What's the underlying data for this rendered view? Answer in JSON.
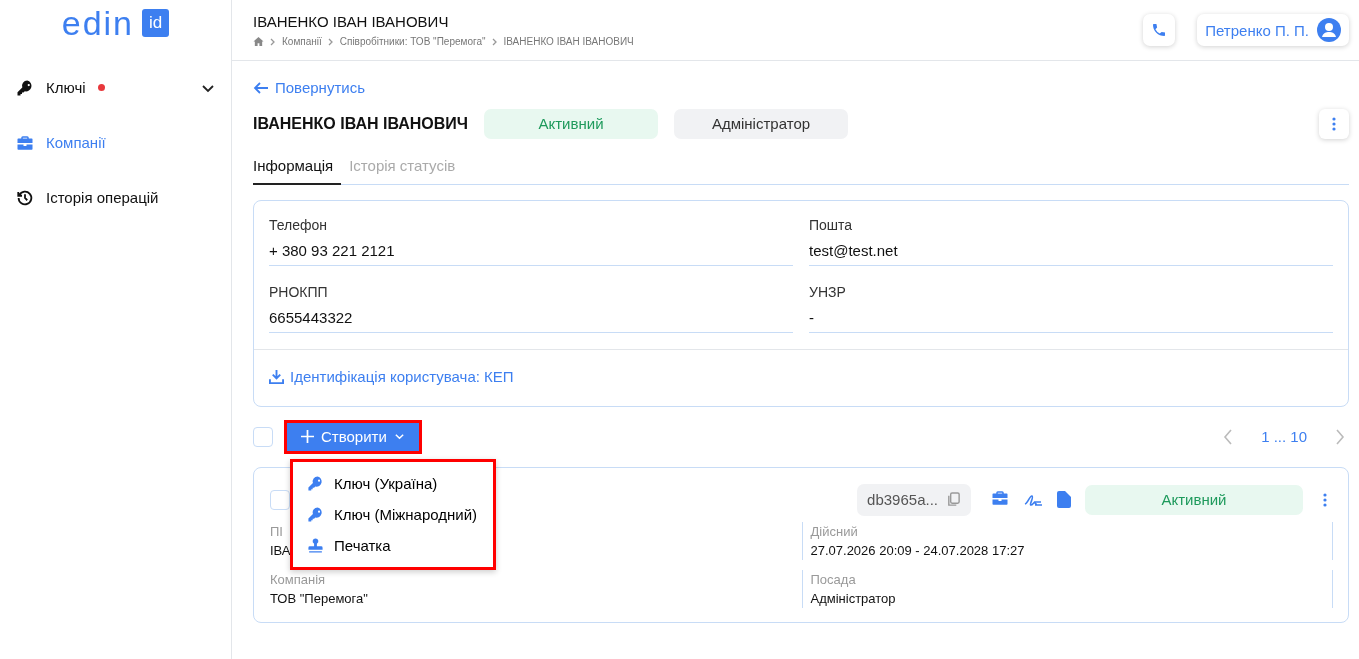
{
  "logo": {
    "text": "edin",
    "badge": "id"
  },
  "sidebar": {
    "items": [
      {
        "label": "Ключі",
        "kind": "key",
        "selected": false,
        "has_dot": true,
        "expandable": true
      },
      {
        "label": "Компанії",
        "kind": "briefcase",
        "selected": true,
        "has_dot": false,
        "expandable": false
      },
      {
        "label": "Історія операцій",
        "kind": "history",
        "selected": false,
        "has_dot": false,
        "expandable": false
      }
    ]
  },
  "header": {
    "title": "ІВАНЕНКО ІВАН ІВАНОВИЧ",
    "breadcrumbs": [
      "Компанії",
      "Співробітники: ТОВ \"Перемога\"",
      "ІВАНЕНКО ІВАН ІВАНОВИЧ"
    ],
    "user": "Петренко П. П."
  },
  "back_link": "Повернутись",
  "person": {
    "name": "ІВАНЕНКО ІВАН ІВАНОВИЧ",
    "status": "Активний",
    "role": "Адміністратор"
  },
  "tabs": [
    {
      "label": "Інформація",
      "selected": true
    },
    {
      "label": "Історія статусів",
      "selected": false
    }
  ],
  "info": {
    "fields": [
      {
        "label": "Телефон",
        "value": "+ 380 93 221 2121"
      },
      {
        "label": "Пошта",
        "value": "test@test.net"
      },
      {
        "label": "РНОКПП",
        "value": "6655443322"
      },
      {
        "label": "УНЗР",
        "value": "-"
      }
    ],
    "link": "Ідентифікація користувача: КЕП"
  },
  "toolbar": {
    "select_all_checked": false,
    "create_button": "Створити",
    "pagination": "1 ... 10"
  },
  "create_menu": [
    {
      "label": "Ключ (Україна)",
      "kind": "key"
    },
    {
      "label": "Ключ (Міжнародний)",
      "kind": "key"
    },
    {
      "label": "Печатка",
      "kind": "stamp"
    }
  ],
  "key_card": {
    "checked": false,
    "id": "db3965a...",
    "status": "Активний",
    "fields": [
      {
        "label": "ПІ",
        "value": "ІВА"
      },
      {
        "label": "Дійсний",
        "value": "27.07.2026 20:09 - 24.07.2028 17:27"
      },
      {
        "label": "Компанія",
        "value": "ТОВ \"Перемога\""
      },
      {
        "label": "Посада",
        "value": "Адміністратор"
      }
    ]
  }
}
